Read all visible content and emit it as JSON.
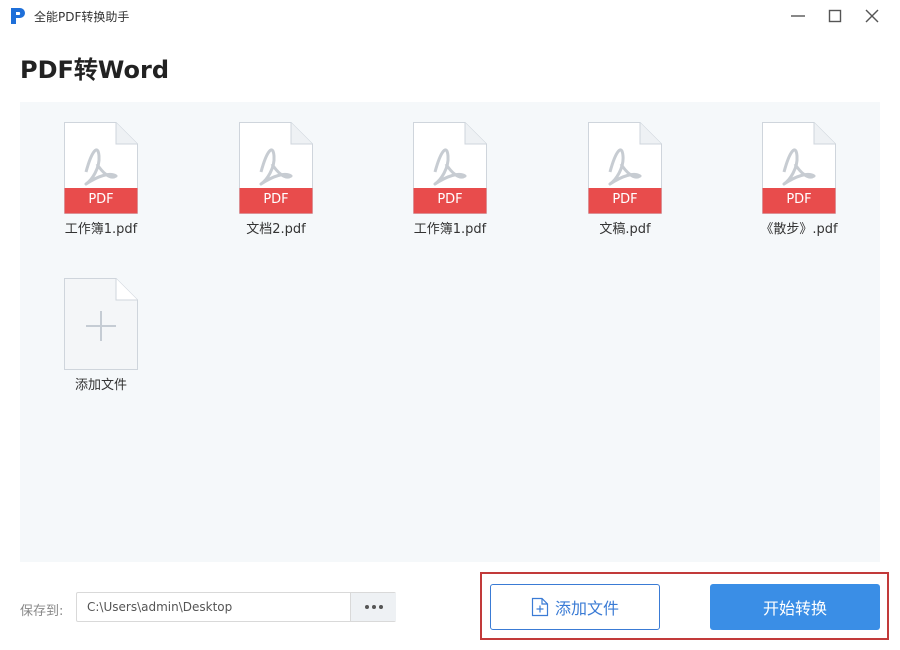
{
  "window": {
    "title": "全能PDF转换助手",
    "brand_color": "#1e6fd9",
    "controls": [
      "minimize-icon",
      "maximize-icon",
      "close-icon"
    ]
  },
  "page": {
    "title": "PDF转Word"
  },
  "files": [
    {
      "name": "工作簿1.pdf",
      "badge": "PDF"
    },
    {
      "name": "文档2.pdf",
      "badge": "PDF"
    },
    {
      "name": "工作簿1.pdf",
      "badge": "PDF"
    },
    {
      "name": "文稿.pdf",
      "badge": "PDF"
    },
    {
      "name": "《散步》.pdf",
      "badge": "PDF"
    }
  ],
  "add_tile": {
    "label": "添加文件",
    "icon": "plus-icon"
  },
  "save": {
    "label": "保存到:",
    "path": "C:\\Users\\admin\\Desktop",
    "browse_icon": "more-dots-icon"
  },
  "actions": {
    "add_label": "添加文件",
    "add_icon": "add-file-icon",
    "start_label": "开始转换"
  },
  "colors": {
    "pdf_badge": "#e84c4c",
    "accent": "#3a8ee6",
    "highlight": "#c23a3a"
  }
}
